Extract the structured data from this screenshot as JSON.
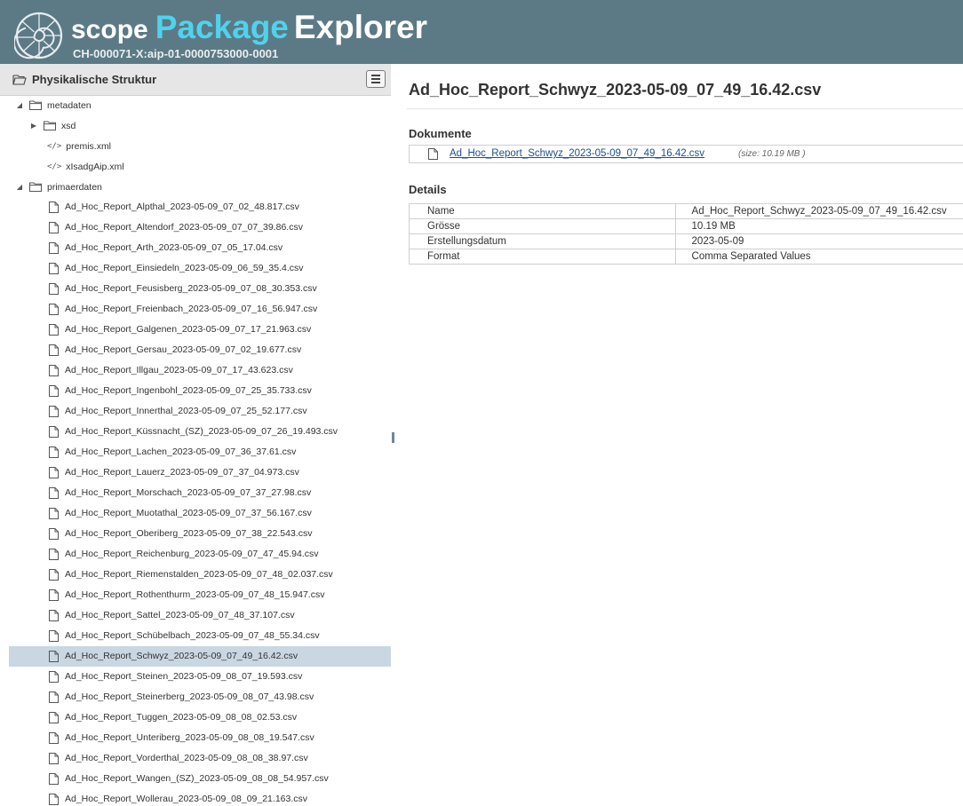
{
  "app": {
    "brand_scope": "scope",
    "brand_package": "Package",
    "brand_explorer": "Explorer",
    "aip_id": "CH-000071-X:aip-01-0000753000-0001",
    "colors": {
      "header_bg": "#5c7a86",
      "accent": "#4fd3ec",
      "selection": "#c9d7e2"
    }
  },
  "sidebar": {
    "title": "Physikalische Struktur",
    "menu_icon": "hamburger-icon",
    "tree": {
      "metadaten": "metadaten",
      "xsd": "xsd",
      "premis": "premis.xml",
      "xlsadg": "xIsadgAip.xml",
      "primaerdaten": "primaerdaten",
      "code_glyph": "</>"
    },
    "files": [
      "Ad_Hoc_Report_Alpthal_2023-05-09_07_02_48.817.csv",
      "Ad_Hoc_Report_Altendorf_2023-05-09_07_07_39.86.csv",
      "Ad_Hoc_Report_Arth_2023-05-09_07_05_17.04.csv",
      "Ad_Hoc_Report_Einsiedeln_2023-05-09_06_59_35.4.csv",
      "Ad_Hoc_Report_Feusisberg_2023-05-09_07_08_30.353.csv",
      "Ad_Hoc_Report_Freienbach_2023-05-09_07_16_56.947.csv",
      "Ad_Hoc_Report_Galgenen_2023-05-09_07_17_21.963.csv",
      "Ad_Hoc_Report_Gersau_2023-05-09_07_02_19.677.csv",
      "Ad_Hoc_Report_Illgau_2023-05-09_07_17_43.623.csv",
      "Ad_Hoc_Report_Ingenbohl_2023-05-09_07_25_35.733.csv",
      "Ad_Hoc_Report_Innerthal_2023-05-09_07_25_52.177.csv",
      "Ad_Hoc_Report_Küssnacht_(SZ)_2023-05-09_07_26_19.493.csv",
      "Ad_Hoc_Report_Lachen_2023-05-09_07_36_37.61.csv",
      "Ad_Hoc_Report_Lauerz_2023-05-09_07_37_04.973.csv",
      "Ad_Hoc_Report_Morschach_2023-05-09_07_37_27.98.csv",
      "Ad_Hoc_Report_Muotathal_2023-05-09_07_37_56.167.csv",
      "Ad_Hoc_Report_Oberiberg_2023-05-09_07_38_22.543.csv",
      "Ad_Hoc_Report_Reichenburg_2023-05-09_07_47_45.94.csv",
      "Ad_Hoc_Report_Riemenstalden_2023-05-09_07_48_02.037.csv",
      "Ad_Hoc_Report_Rothenthurm_2023-05-09_07_48_15.947.csv",
      "Ad_Hoc_Report_Sattel_2023-05-09_07_48_37.107.csv",
      "Ad_Hoc_Report_Schübelbach_2023-05-09_07_48_55.34.csv",
      "Ad_Hoc_Report_Schwyz_2023-05-09_07_49_16.42.csv",
      "Ad_Hoc_Report_Steinen_2023-05-09_08_07_19.593.csv",
      "Ad_Hoc_Report_Steinerberg_2023-05-09_08_07_43.98.csv",
      "Ad_Hoc_Report_Tuggen_2023-05-09_08_08_02.53.csv",
      "Ad_Hoc_Report_Unteriberg_2023-05-09_08_08_19.547.csv",
      "Ad_Hoc_Report_Vorderthal_2023-05-09_08_08_38.97.csv",
      "Ad_Hoc_Report_Wangen_(SZ)_2023-05-09_08_08_54.957.csv",
      "Ad_Hoc_Report_Wollerau_2023-05-09_08_09_21.163.csv"
    ],
    "selected_file": "Ad_Hoc_Report_Schwyz_2023-05-09_07_49_16.42.csv"
  },
  "main": {
    "title": "Ad_Hoc_Report_Schwyz_2023-05-09_07_49_16.42.csv",
    "documents_heading": "Dokumente",
    "document_link": "Ad_Hoc_Report_Schwyz_2023-05-09_07_49_16.42.csv",
    "document_size": "(size: 10.19 MB )",
    "details_heading": "Details",
    "details": [
      {
        "key": "Name",
        "value": "Ad_Hoc_Report_Schwyz_2023-05-09_07_49_16.42.csv"
      },
      {
        "key": "Grösse",
        "value": "10.19 MB"
      },
      {
        "key": "Erstellungsdatum",
        "value": "2023-05-09"
      },
      {
        "key": "Format",
        "value": "Comma Separated Values"
      }
    ]
  }
}
